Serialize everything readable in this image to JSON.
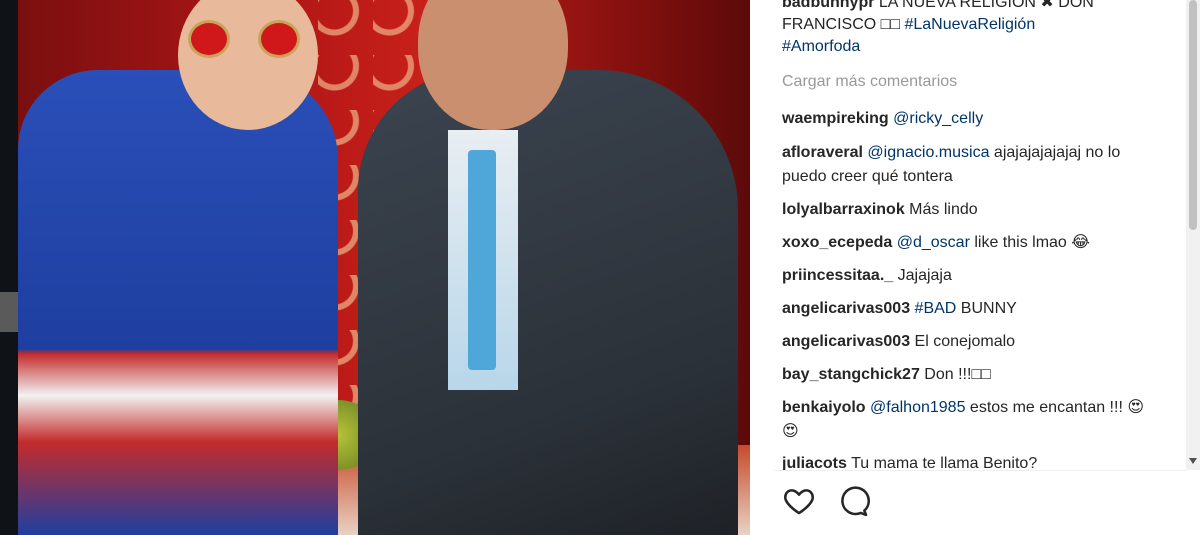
{
  "caption": {
    "user": "badbunnypr",
    "text_before": " LA NUEVA RELIGION ",
    "text_after": " DON FRANCISCO ",
    "hashtag1": "#LaNuevaReligión",
    "hashtag2": "#Amorfoda"
  },
  "load_more": "Cargar más comentarios",
  "comments": [
    {
      "user": "waempireking",
      "mention": "@ricky_celly",
      "text": ""
    },
    {
      "user": "afloraveral",
      "mention": "@ignacio.musica",
      "text": " ajajajajajajaj no lo puedo creer qué tontera"
    },
    {
      "user": "lolyalbarraxinok",
      "mention": "",
      "text": " Más lindo"
    },
    {
      "user": "xoxo_ecepeda",
      "mention": "@d_oscar",
      "text": " like this lmao 😂"
    },
    {
      "user": "priincessitaa._",
      "mention": "",
      "text": " Jajajaja"
    },
    {
      "user": "angelicarivas003",
      "mention": "#BAD",
      "text": " BUNNY"
    },
    {
      "user": "angelicarivas003",
      "mention": "",
      "text": " El conejomalo"
    },
    {
      "user": "bay_stangchick27",
      "mention": "",
      "text": " Don !!!"
    },
    {
      "user": "benkaiyolo",
      "mention": "@falhon1985",
      "text": " estos me encantan !!! 😍😍"
    },
    {
      "user": "juliacots",
      "mention": "",
      "text": " Tu mama te llama Benito?"
    }
  ],
  "icons": {
    "like": "heart-icon",
    "comment": "comment-bubble-icon"
  },
  "colors": {
    "link": "#003569",
    "muted": "#999999",
    "text": "#262626"
  }
}
